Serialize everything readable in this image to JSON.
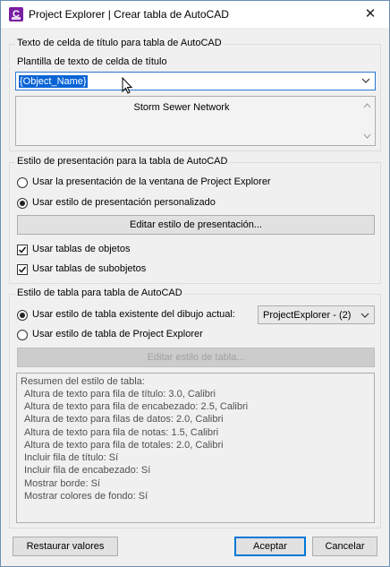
{
  "window": {
    "title": "Project Explorer | Crear tabla de AutoCAD",
    "icon_glyph": "C",
    "close_glyph": "✕"
  },
  "title_cell": {
    "group_label": "Texto de celda de título para tabla de AutoCAD",
    "template_label": "Plantilla de texto de celda de título",
    "template_value": "{Object_Name}",
    "preview_text": "Storm Sewer Network"
  },
  "presentation": {
    "group_label": "Estilo de presentación para la tabla de AutoCAD",
    "option_window": "Usar la presentación de la ventana de Project Explorer",
    "option_custom": "Usar estilo de presentación personalizado",
    "selected_option": "custom",
    "edit_button": "Editar estilo de presentación...",
    "check_object_tables": "Usar tablas de objetos",
    "check_object_tables_checked": true,
    "check_subobject_tables": "Usar tablas de subobjetos",
    "check_subobject_tables_checked": true
  },
  "table_style": {
    "group_label": "Estilo de tabla para tabla de AutoCAD",
    "option_existing": "Usar estilo de tabla existente del dibujo actual:",
    "option_explorer": "Usar estilo de tabla de Project Explorer",
    "selected_option": "existing",
    "existing_style_value": "ProjectExplorer - (2)",
    "edit_button": "Editar estilo de tabla...",
    "summary": [
      "Resumen del estilo de tabla:",
      "  Altura de texto para fila de título: 3.0, Calibri",
      "  Altura de texto para fila de encabezado: 2.5, Calibri",
      "  Altura de texto para filas de datos: 2.0, Calibri",
      "  Altura de texto para fila de notas: 1.5, Calibri",
      "  Altura de texto para fila de totales: 2.0, Calibri",
      "  Incluir fila de título: Sí",
      "  Incluir fila de encabezado: Sí",
      "  Mostrar borde: Sí",
      "  Mostrar colores de fondo: Sí"
    ]
  },
  "footer": {
    "reset_button": "Restaurar valores",
    "accept_button": "Aceptar",
    "cancel_button": "Cancelar"
  },
  "colors": {
    "accent": "#0078d7",
    "selection": "#0a64d6",
    "app_icon": "#7a1fa2"
  }
}
